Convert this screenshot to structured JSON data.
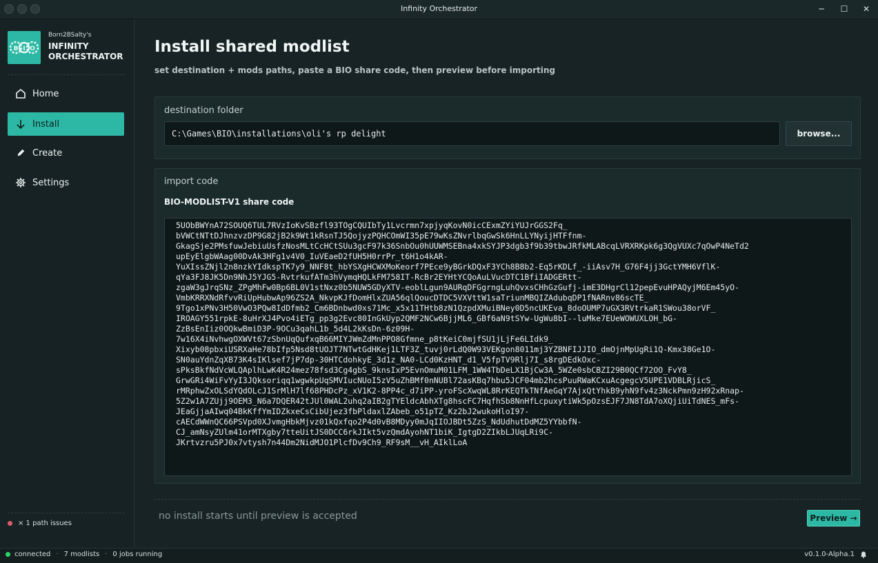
{
  "window": {
    "title": "Infinity Orchestrator",
    "minimize": "─",
    "maximize": "☐",
    "close": "✕"
  },
  "brand": {
    "small": "Born2BSalty's",
    "line1": "INFINITY",
    "line2": "ORCHESTRATOR",
    "logo_letters": "BIO"
  },
  "nav": [
    {
      "label": "Home",
      "icon": "home-icon"
    },
    {
      "label": "Install",
      "icon": "arrow-down-icon"
    },
    {
      "label": "Create",
      "icon": "pencil-icon"
    },
    {
      "label": "Settings",
      "icon": "gear-icon"
    }
  ],
  "sidebar_footer": {
    "path_issues": "× 1 path issues"
  },
  "page": {
    "title": "Install shared modlist",
    "subtitle": "set destination + mods paths, paste a BIO share code, then preview before importing"
  },
  "destination": {
    "label": "destination folder",
    "value": "C:\\Games\\BIO\\installations\\oli's rp delight",
    "browse_label": "browse..."
  },
  "import": {
    "label": "import code",
    "code_label": "BIO-MODLIST-V1 share code",
    "code_lines": [
      "5UObBWYnA72SOUQ6TUL7RVzIoKvSBzfl93TOgCQUIbTy1Lvcrmn7xpjyqKovN0icCExmZYiYUJrGGS2Fq_",
      "bVWCtNTtDJhnzvzDP9G82jB2k9Wt1kRsnTJ5QojyzPQHCOmWI35pE79wKsZNvrlbqGwSk6HnLLYNyijHTFfnm-",
      "GkagSje2PMsfuwJebiuUsfzNosMLtCcHCtSUu3gcF97k36SnbOu0hUUWMSEBna4xkSYJP3dgb3f9b39tbwJRfkMLABcqLVRXRKpk6g3QgVUXc7qOwP4NeTd2",
      "upEyElgbWAag00DvAk3HFg1v4V0_IuVEaeD2fUH5H0rrPr_t6H1o4kAR-",
      "YuXIssZNjl2n8nzkYIdkspTK7y9_NNF8t_hbYSXgHCWXMoKeorf7PEce9yBGrkDQxF3YCh8B8b2-Eq5rKDLf_-iiAsv7H_G76F4jj3GctYMH6VflK-",
      "qYa3FJ8JK5Dn9NhJ5YJG5-RvtrkufATm3hVymqHQLkFM758IT-RcBr2EYHtYCQoAuLVucDTC1BfiIADGERtt-",
      "zgaW3gJrqSNz_ZPgMhFw0Bp6BL0V1stNxz0b5NUW5GDyXTV-eoblLgun9AURqDFGgrngLuhQvxsCHhGzGufj-imE3DHgrCl12pepEvuHPAQyjM6Em45yO-",
      "VmbKRRXNdRfvvRiUpHubwAp96ZS2A_NkvpKJfDomHlxZUA56qlQoucDTDC5VXVttW1saTriunMBQIZAdubqDP1fNARnv86scTE_",
      "9Tgo1xPNv3H50VwO3PQw8IdDfmb2_Cm6BDnbwd0xs71Mc_x5x11THtb8zN1QzpdXMuiBNey0D5ncUKEva_8doOUMP7uGX3RVtrkaR1SWou38orVF_",
      "IROAGY551rpkE-8uHrXJ4Pvo4iETg_pp3g2Evc80InGkUyp2QMF2NCw6BjjML6_GBf6aN9tSYw-UgWu8bI--luMke7EUeWOWUXLOH_bG-",
      "ZzBsEnIiz0OQkwBmiD3P-9OCu3qahL1b_5d4L2kKsDn-6z09H-",
      "7w16X4iNvhwgOXWVt67zSbnUqQufxqB66MIYJWmZdMnPPO8Gfmne_p8tKeiC0mjfSU1jLjFe6LIdk9_",
      "Xixyb08pbxiUSRXaHe78bIfp5Nsd8tUOJT7NTwtGdHKej1LTF3Z_tuvj0rLdQ0W93VEKgon8011mj3YZBNFIJJIO_dmOjnMpUgRi1Q-Kmx38Ge1O-",
      "SN0auYdnZqXB73K4sIKlsef7jP7dp-30HTCdohkyE_3d1z_NA0-LCd0KzHNT_d1_V5fpTV9Rlj7I_s8rgDEdkOxc-",
      "sPksBkfNdVcWLQAplhLwK4R24mez78fsd3Cg4gbS_9knsIxP5EvnOmuM01LFM_1WW4TbDeLX1BjCw3A_5WZe0sbCBZI29B0QCf72OO_FvY8_",
      "GrwGRi4WiFvYyI3JQksoriqq1wgwkpUqSMVIucNUoI5zV5uZhBMf0nNUBl72asKBq7hbu5JCF04mb2hcsPuuRWaKCxuAcgegcV5UPE1VDBLRjicS_",
      "rMRphwZxOLSdYQdOLcJ1SrMlH7lf68PHDcPz_xV1K2-8PP4c_d7iPP-yroFScXwqWL8RrKEQTkTNfAeGqY7AjxQtYhkB9yhN9fv4z3NckPmn9zH92xRnap-",
      "5Z2w1A7ZUjj9OEM3_N6a7DQER42tJUl0WAL2uhq2aIB2gTYEldcAbhXTg8hscFC7HqfhSb8NnHfLcpuxytiWk5pOzsEJF7JN8TdA7oXQjiUiTdNES_mFs-",
      "JEaGjjaAIwq04BkKffYmIDZkxeCsCibUjez3fbPldaxlZAbeb_o51pTZ_Kz2bJ2wukoHloI97-",
      "cAECdWWnQC66PSVpd0XJvmgHbkMjvz01kQxfqo2P4d0vB8MDyy0mJqIIOJBDt5ZzS_NdUdhutDdMZ5YYbbfN-",
      "CJ_amNsyZUlm41orMTXgby7tteUitJS0DCC6rkJIkt5vzQmdAyohNT1biK_IgtgD2ZIkbLJUqLRi9C-",
      "JKrtvzru5PJ0x7vtysh7n44Dm2NidMJO1PlcfDv9Ch9_RF9sM__vH_AIklLoA"
    ]
  },
  "footer": {
    "no_install": "no install starts until preview is accepted",
    "preview_label": "Preview →"
  },
  "statusbar": {
    "connected": "connected",
    "modlists": "7 modlists",
    "jobs": "0 jobs running",
    "version": "v0.1.0-Alpha.1",
    "bell_icon": "bell-icon"
  },
  "colors": {
    "accent": "#2cb8a4",
    "background": "#172324",
    "sidebar": "#162223",
    "status_ok": "#2bd46a",
    "status_error": "#e05a6a"
  }
}
